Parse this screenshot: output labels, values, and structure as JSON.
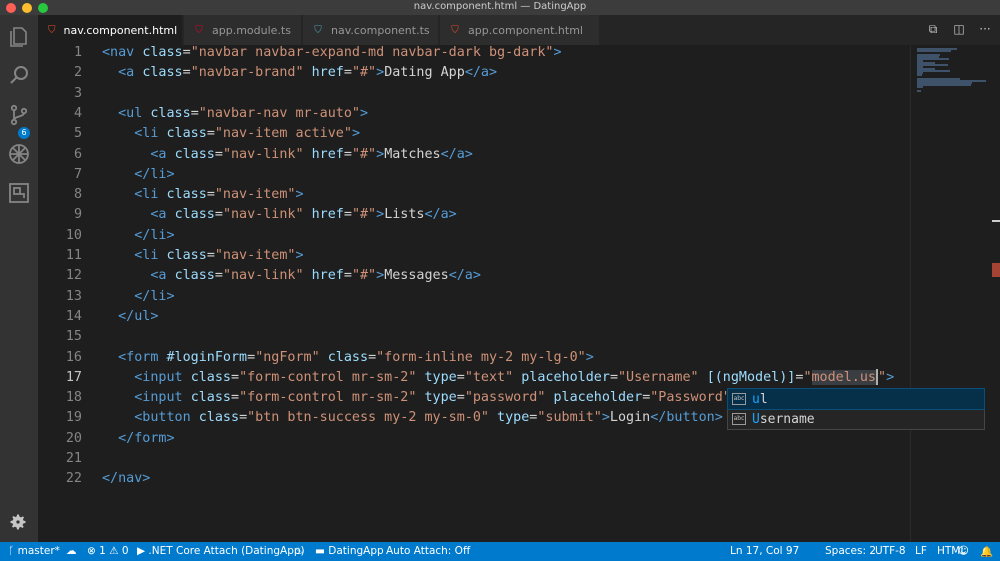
{
  "window": {
    "title": "nav.component.html — DatingApp"
  },
  "activity_bar": {
    "icons": [
      "explorer-icon",
      "search-icon",
      "source-control-icon",
      "debug-icon",
      "extensions-icon"
    ],
    "scm_badge": "6",
    "settings_icon": "gear-icon"
  },
  "tabs": [
    {
      "label": "nav.component.html",
      "icon": "html5-icon",
      "active": true
    },
    {
      "label": "app.module.ts",
      "icon": "angular-icon",
      "active": false
    },
    {
      "label": "nav.component.ts",
      "icon": "angular-icon",
      "active": false
    },
    {
      "label": "app.component.html",
      "icon": "html5-icon",
      "active": false
    }
  ],
  "tab_close": "×",
  "editor": {
    "lines": [
      {
        "n": "1",
        "segs": [
          [
            "tg",
            "<nav "
          ],
          [
            "at",
            "class"
          ],
          [
            "tx",
            "="
          ],
          [
            "st",
            "\"navbar navbar-expand-md navbar-dark bg-dark\""
          ],
          [
            "tg",
            ">"
          ]
        ]
      },
      {
        "n": "2",
        "segs": [
          [
            "tx",
            "  "
          ],
          [
            "tg",
            "<a "
          ],
          [
            "at",
            "class"
          ],
          [
            "tx",
            "="
          ],
          [
            "st",
            "\"navbar-brand\""
          ],
          [
            "tx",
            " "
          ],
          [
            "at",
            "href"
          ],
          [
            "tx",
            "="
          ],
          [
            "st",
            "\"#\""
          ],
          [
            "tg",
            ">"
          ],
          [
            "tx",
            "Dating App"
          ],
          [
            "tg",
            "</a>"
          ]
        ]
      },
      {
        "n": "3",
        "segs": []
      },
      {
        "n": "4",
        "segs": [
          [
            "tx",
            "  "
          ],
          [
            "tg",
            "<ul "
          ],
          [
            "at",
            "class"
          ],
          [
            "tx",
            "="
          ],
          [
            "st",
            "\"navbar-nav mr-auto\""
          ],
          [
            "tg",
            ">"
          ]
        ]
      },
      {
        "n": "5",
        "segs": [
          [
            "tx",
            "    "
          ],
          [
            "tg",
            "<li "
          ],
          [
            "at",
            "class"
          ],
          [
            "tx",
            "="
          ],
          [
            "st",
            "\"nav-item active\""
          ],
          [
            "tg",
            ">"
          ]
        ]
      },
      {
        "n": "6",
        "segs": [
          [
            "tx",
            "      "
          ],
          [
            "tg",
            "<a "
          ],
          [
            "at",
            "class"
          ],
          [
            "tx",
            "="
          ],
          [
            "st",
            "\"nav-link\""
          ],
          [
            "tx",
            " "
          ],
          [
            "at",
            "href"
          ],
          [
            "tx",
            "="
          ],
          [
            "st",
            "\"#\""
          ],
          [
            "tg",
            ">"
          ],
          [
            "tx",
            "Matches"
          ],
          [
            "tg",
            "</a>"
          ]
        ]
      },
      {
        "n": "7",
        "segs": [
          [
            "tx",
            "    "
          ],
          [
            "tg",
            "</li>"
          ]
        ]
      },
      {
        "n": "8",
        "segs": [
          [
            "tx",
            "    "
          ],
          [
            "tg",
            "<li "
          ],
          [
            "at",
            "class"
          ],
          [
            "tx",
            "="
          ],
          [
            "st",
            "\"nav-item\""
          ],
          [
            "tg",
            ">"
          ]
        ]
      },
      {
        "n": "9",
        "segs": [
          [
            "tx",
            "      "
          ],
          [
            "tg",
            "<a "
          ],
          [
            "at",
            "class"
          ],
          [
            "tx",
            "="
          ],
          [
            "st",
            "\"nav-link\""
          ],
          [
            "tx",
            " "
          ],
          [
            "at",
            "href"
          ],
          [
            "tx",
            "="
          ],
          [
            "st",
            "\"#\""
          ],
          [
            "tg",
            ">"
          ],
          [
            "tx",
            "Lists"
          ],
          [
            "tg",
            "</a>"
          ]
        ]
      },
      {
        "n": "10",
        "segs": [
          [
            "tx",
            "    "
          ],
          [
            "tg",
            "</li>"
          ]
        ]
      },
      {
        "n": "11",
        "segs": [
          [
            "tx",
            "    "
          ],
          [
            "tg",
            "<li "
          ],
          [
            "at",
            "class"
          ],
          [
            "tx",
            "="
          ],
          [
            "st",
            "\"nav-item\""
          ],
          [
            "tg",
            ">"
          ]
        ]
      },
      {
        "n": "12",
        "segs": [
          [
            "tx",
            "      "
          ],
          [
            "tg",
            "<a "
          ],
          [
            "at",
            "class"
          ],
          [
            "tx",
            "="
          ],
          [
            "st",
            "\"nav-link\""
          ],
          [
            "tx",
            " "
          ],
          [
            "at",
            "href"
          ],
          [
            "tx",
            "="
          ],
          [
            "st",
            "\"#\""
          ],
          [
            "tg",
            ">"
          ],
          [
            "tx",
            "Messages"
          ],
          [
            "tg",
            "</a>"
          ]
        ]
      },
      {
        "n": "13",
        "segs": [
          [
            "tx",
            "    "
          ],
          [
            "tg",
            "</li>"
          ]
        ]
      },
      {
        "n": "14",
        "segs": [
          [
            "tx",
            "  "
          ],
          [
            "tg",
            "</ul>"
          ]
        ]
      },
      {
        "n": "15",
        "segs": []
      },
      {
        "n": "16",
        "segs": [
          [
            "tx",
            "  "
          ],
          [
            "tg",
            "<form "
          ],
          [
            "at",
            "#loginForm"
          ],
          [
            "tx",
            "="
          ],
          [
            "st",
            "\"ngForm\""
          ],
          [
            "tx",
            " "
          ],
          [
            "at",
            "class"
          ],
          [
            "tx",
            "="
          ],
          [
            "st",
            "\"form-inline my-2 my-lg-0\""
          ],
          [
            "tg",
            ">"
          ]
        ]
      },
      {
        "n": "17",
        "segs": [
          [
            "tx",
            "    "
          ],
          [
            "tg",
            "<input "
          ],
          [
            "at",
            "class"
          ],
          [
            "tx",
            "="
          ],
          [
            "st",
            "\"form-control mr-sm-2\""
          ],
          [
            "tx",
            " "
          ],
          [
            "at",
            "type"
          ],
          [
            "tx",
            "="
          ],
          [
            "st",
            "\"text\""
          ],
          [
            "tx",
            " "
          ],
          [
            "at",
            "placeholder"
          ],
          [
            "tx",
            "="
          ],
          [
            "st",
            "\"Username\""
          ],
          [
            "tx",
            " "
          ],
          [
            "at",
            "[(ngModel)]"
          ],
          [
            "tx",
            "="
          ],
          [
            "st",
            "\""
          ],
          [
            "hl",
            "model.us"
          ],
          [
            "cur",
            ""
          ],
          [
            "st",
            "\""
          ],
          [
            "tg",
            ">"
          ]
        ]
      },
      {
        "n": "18",
        "segs": [
          [
            "tx",
            "    "
          ],
          [
            "tg",
            "<input "
          ],
          [
            "at",
            "class"
          ],
          [
            "tx",
            "="
          ],
          [
            "st",
            "\"form-control mr-sm-2\""
          ],
          [
            "tx",
            " "
          ],
          [
            "at",
            "type"
          ],
          [
            "tx",
            "="
          ],
          [
            "st",
            "\"password\""
          ],
          [
            "tx",
            " "
          ],
          [
            "at",
            "placeholder"
          ],
          [
            "tx",
            "="
          ],
          [
            "st",
            "\"Password\""
          ],
          [
            "tg",
            ">"
          ]
        ]
      },
      {
        "n": "19",
        "segs": [
          [
            "tx",
            "    "
          ],
          [
            "tg",
            "<button "
          ],
          [
            "at",
            "class"
          ],
          [
            "tx",
            "="
          ],
          [
            "st",
            "\"btn btn-success my-2 my-sm-0\""
          ],
          [
            "tx",
            " "
          ],
          [
            "at",
            "type"
          ],
          [
            "tx",
            "="
          ],
          [
            "st",
            "\"submit\""
          ],
          [
            "tg",
            ">"
          ],
          [
            "tx",
            "Login"
          ],
          [
            "tg",
            "</button>"
          ]
        ]
      },
      {
        "n": "20",
        "segs": [
          [
            "tx",
            "  "
          ],
          [
            "tg",
            "</form>"
          ]
        ]
      },
      {
        "n": "21",
        "segs": []
      },
      {
        "n": "22",
        "segs": [
          [
            "tg",
            "</nav>"
          ]
        ]
      }
    ],
    "current_line": "17"
  },
  "suggestions": [
    {
      "match": "u",
      "rest": "l",
      "kind": "abc",
      "selected": true
    },
    {
      "match": "U",
      "rest": "sername",
      "kind": "abc",
      "selected": false
    }
  ],
  "status": {
    "branch": "master*",
    "sync_icon": "cloud-sync-icon",
    "errors": "1",
    "warnings": "0",
    "debug_target": ".NET Core Attach (DatingApp)",
    "workspace": "DatingApp",
    "auto_attach": "Auto Attach: Off",
    "position": "Ln 17, Col 97",
    "spaces": "Spaces: 2",
    "encoding": "UTF-8",
    "eol": "LF",
    "language": "HTML"
  }
}
